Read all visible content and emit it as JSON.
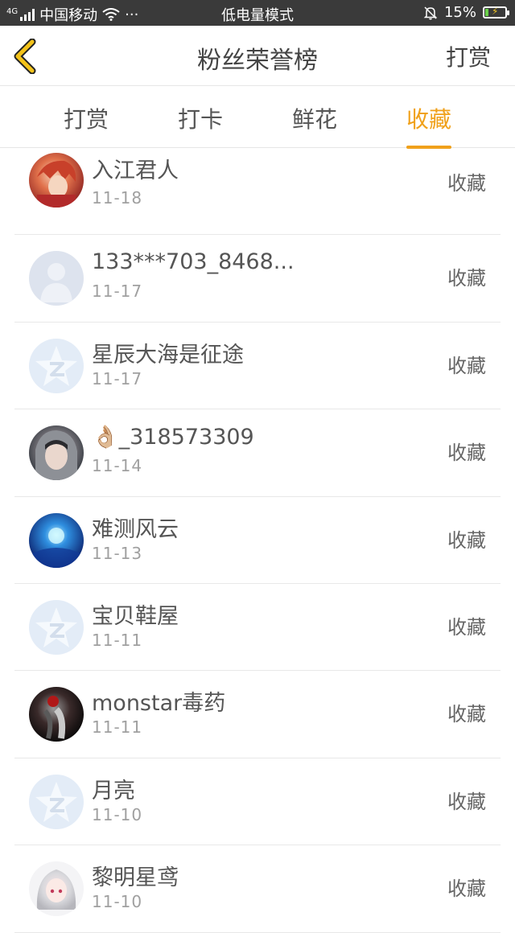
{
  "status_bar": {
    "network": "4G",
    "carrier": "中国移动",
    "dots": "···",
    "mode": "低电量模式",
    "battery": "15%"
  },
  "nav": {
    "title": "粉丝荣誉榜",
    "right_action": "打赏"
  },
  "tabs": [
    {
      "label": "打赏",
      "active": false
    },
    {
      "label": "打卡",
      "active": false
    },
    {
      "label": "鲜花",
      "active": false
    },
    {
      "label": "收藏",
      "active": true
    }
  ],
  "colors": {
    "accent": "#f0a11b",
    "statusbar_bg": "#3a3a3a",
    "divider": "#e8e8e8"
  },
  "fans": [
    {
      "name": "入江君人",
      "date": "11-18",
      "action": "收藏",
      "avatar": "anime-red-hair-avatar"
    },
    {
      "name": "133***703_8468...",
      "date": "11-17",
      "action": "收藏",
      "avatar": "default-person-avatar"
    },
    {
      "name": "星辰大海是征途",
      "date": "11-17",
      "action": "收藏",
      "avatar": "default-star-avatar"
    },
    {
      "name": "👌🏼_318573309",
      "date": "11-14",
      "action": "收藏",
      "avatar": "girl-photo-avatar"
    },
    {
      "name": "难测风云",
      "date": "11-13",
      "action": "收藏",
      "avatar": "blue-galaxy-avatar"
    },
    {
      "name": "宝贝鞋屋",
      "date": "11-11",
      "action": "收藏",
      "avatar": "default-star-avatar"
    },
    {
      "name": "monstar毒药",
      "date": "11-11",
      "action": "收藏",
      "avatar": "rose-dark-avatar"
    },
    {
      "name": "月亮",
      "date": "11-10",
      "action": "收藏",
      "avatar": "default-star-avatar"
    },
    {
      "name": "黎明星鸢",
      "date": "11-10",
      "action": "收藏",
      "avatar": "anime-white-hair-avatar"
    }
  ]
}
